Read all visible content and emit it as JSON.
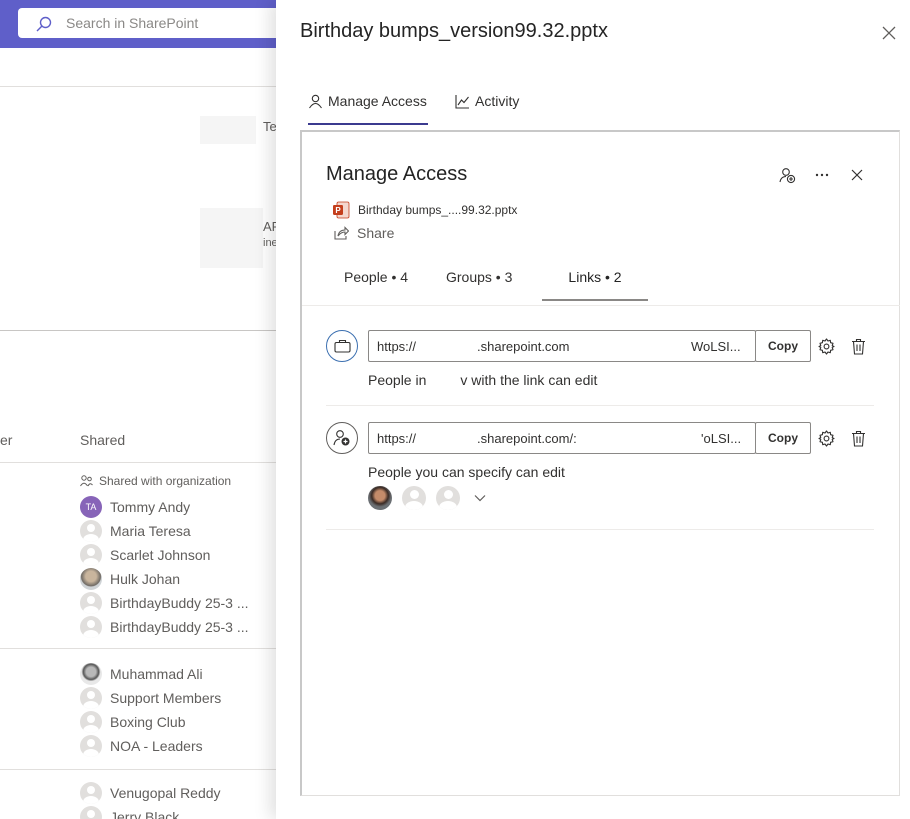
{
  "background": {
    "search_placeholder": "Search in SharePoint",
    "fragment_te": "Te",
    "fragment_af": "AF",
    "fragment_ine": "ine",
    "column_er": "er",
    "column_shared": "Shared",
    "shared_with_org": "Shared with organization",
    "people_group1": [
      {
        "initials": "TA",
        "name": "Tommy Andy",
        "avatar": "initials"
      },
      {
        "name": "Maria Teresa",
        "avatar": "blank"
      },
      {
        "name": "Scarlet Johnson",
        "avatar": "blank"
      },
      {
        "name": "Hulk Johan",
        "avatar": "photo"
      },
      {
        "name": "BirthdayBuddy 25-3 ...",
        "avatar": "blank"
      },
      {
        "name": "BirthdayBuddy 25-3 ...",
        "avatar": "blank"
      }
    ],
    "people_group2": [
      {
        "name": "Muhammad Ali",
        "avatar": "photo"
      },
      {
        "name": "Support Members",
        "avatar": "blank"
      },
      {
        "name": "Boxing Club",
        "avatar": "blank"
      },
      {
        "name": "NOA - Leaders",
        "avatar": "blank"
      }
    ],
    "people_group3": [
      {
        "name": "Venugopal Reddy",
        "avatar": "blank"
      },
      {
        "name": "Jerry Black",
        "avatar": "blank"
      }
    ]
  },
  "panel": {
    "title": "Birthday bumps_version99.32.pptx",
    "tabs": [
      {
        "label": "Manage Access",
        "icon": "person-icon",
        "active": true
      },
      {
        "label": "Activity",
        "icon": "chart-icon",
        "active": false
      }
    ]
  },
  "manage_access": {
    "title": "Manage Access",
    "file_name": "Birthday bumps_....99.32.pptx",
    "share_label": "Share",
    "subtabs": [
      {
        "label": "People • 4"
      },
      {
        "label": "Groups • 3"
      },
      {
        "label": "Links • 2",
        "active": true
      }
    ],
    "links": [
      {
        "icon": "briefcase-icon",
        "url_start": "https://",
        "url_domain": ".sharepoint.com",
        "url_end": "WoLSI...",
        "copy_label": "Copy",
        "description_start": "People in",
        "description_end": "v with the link can edit"
      },
      {
        "icon": "person-add-icon",
        "url_start": "https://",
        "url_domain": ".sharepoint.com/:",
        "url_end": "'oLSI...",
        "copy_label": "Copy",
        "description": "People you can specify can edit"
      }
    ]
  },
  "colors": {
    "topbar": "#5f5fc9",
    "accent": "#3b3a8f",
    "initials_avatar": "#8764b8",
    "pptx_red": "#c43e1c"
  }
}
